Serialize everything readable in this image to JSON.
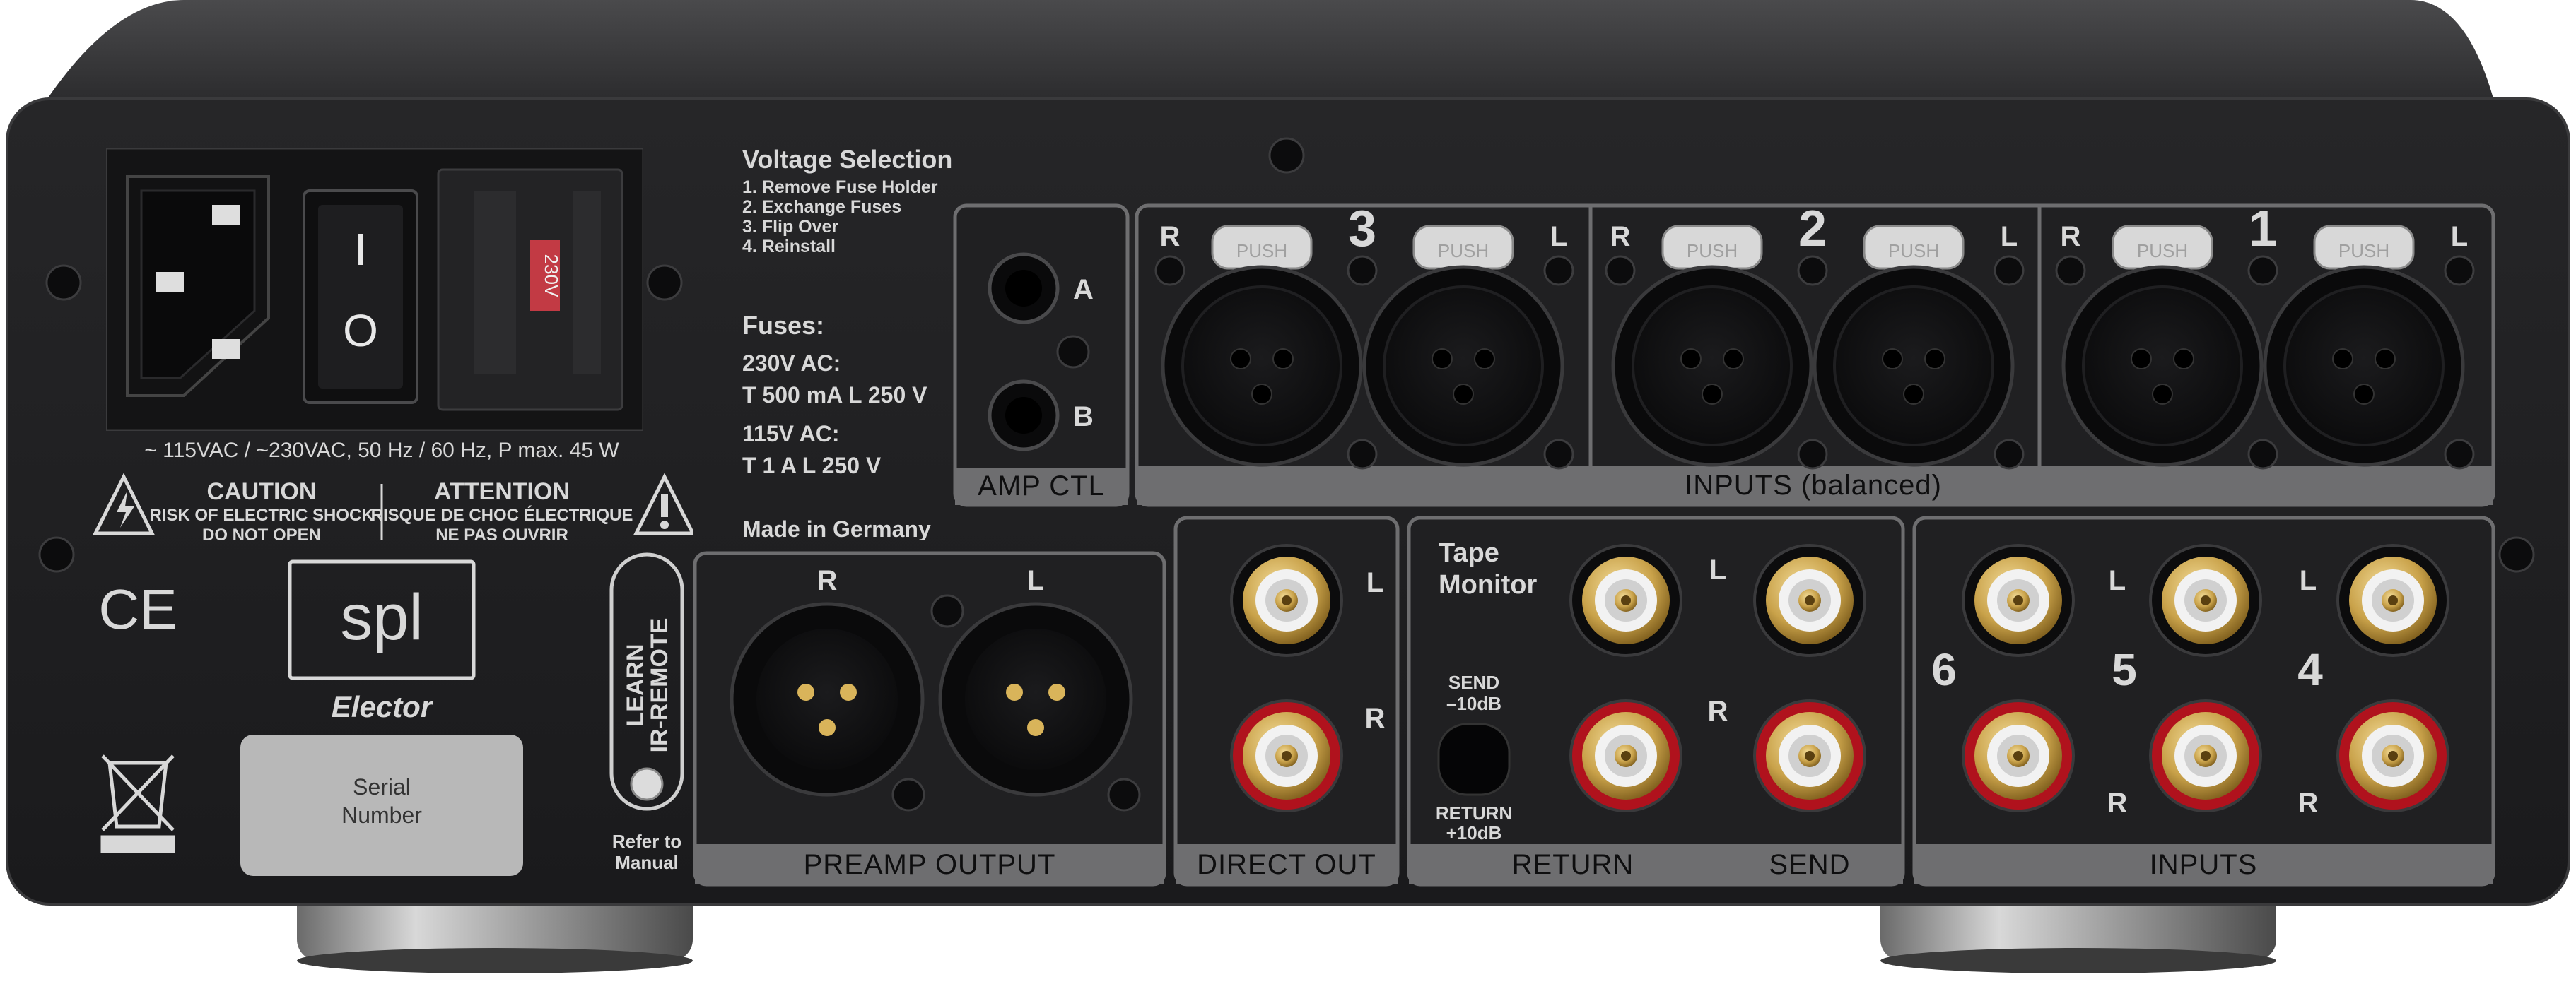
{
  "power": {
    "switch_on": "I",
    "switch_off": "O",
    "fuse_tag": "230V",
    "rating": "~ 115VAC / ~230VAC, 50 Hz / 60 Hz, P max. 45 W"
  },
  "warning": {
    "caution_title": "CAUTION",
    "caution_l1": "RISK OF ELECTRIC SHOCK",
    "caution_l2": "DO NOT OPEN",
    "attention_title": "ATTENTION",
    "attention_l1": "RISQUE DE CHOC ÉLECTRIQUE",
    "attention_l2": "NE PAS OUVRIR"
  },
  "voltage": {
    "title": "Voltage Selection:",
    "steps": [
      "1. Remove Fuse Holder",
      "2. Exchange Fuses",
      "3. Flip Over",
      "4. Reinstall"
    ]
  },
  "fuses": {
    "title": "Fuses:",
    "line1": "230V AC:",
    "line2": "T 500 mA L 250 V",
    "line3": "115V AC:",
    "line4": "T 1 A L 250 V"
  },
  "amp_ctl": {
    "label": "AMP CTL",
    "a": "A",
    "b": "B"
  },
  "balanced_inputs": {
    "label": "INPUTS (balanced)",
    "push": "PUSH",
    "groups": [
      {
        "num": "3",
        "r": "R",
        "l": "L"
      },
      {
        "num": "2",
        "r": "R",
        "l": "L"
      },
      {
        "num": "1",
        "r": "R",
        "l": "L"
      }
    ]
  },
  "branding": {
    "made_in": "Made in Germany",
    "ce": "CE",
    "logo": "spl",
    "model": "Elector",
    "serial": "Serial\nNumber"
  },
  "ir": {
    "label1": "LEARN",
    "label2": "IR-REMOTE",
    "refer1": "Refer to",
    "refer2": "Manual"
  },
  "preamp": {
    "label": "PREAMP OUTPUT",
    "r": "R",
    "l": "L"
  },
  "direct": {
    "label": "DIRECT OUT",
    "l": "L",
    "r": "R"
  },
  "tape": {
    "title1": "Tape",
    "title2": "Monitor",
    "send1": "SEND",
    "send2": "–10dB",
    "ret1": "RETURN",
    "ret2": "+10dB",
    "l": "L",
    "r": "R",
    "return_label": "RETURN",
    "send_label": "SEND"
  },
  "rca_inputs": {
    "label": "INPUTS",
    "nums": [
      "6",
      "5",
      "4"
    ],
    "l": "L",
    "r": "R"
  },
  "colors": {
    "chassis": "#1c1c1e",
    "top": "#3a3a3c",
    "label_bar": "#6e6e70",
    "rca_red": "#b0121d",
    "gold": "#c9a24a"
  }
}
